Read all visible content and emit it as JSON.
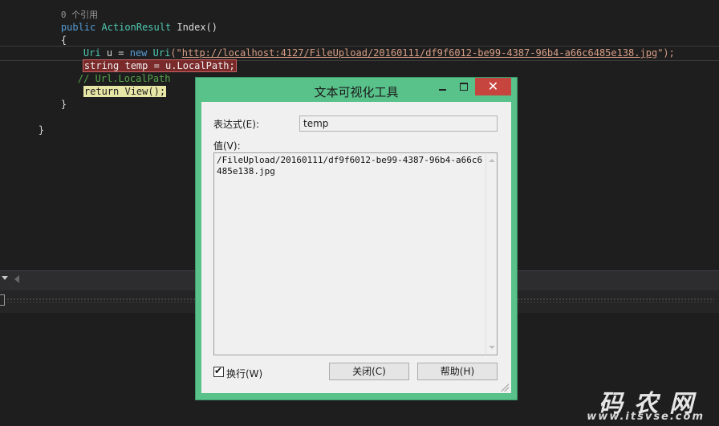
{
  "editor": {
    "references": "0 个引用",
    "lines": {
      "l1_kw": "public",
      "l1_type": "ActionResult",
      "l1_rest": " Index()",
      "l2": "{",
      "l3_type": "Uri",
      "l3_mid": " u = ",
      "l3_kw": "new",
      "l3_type2": " Uri",
      "l3_open": "(\"",
      "l3_url": "http://localhost:4127/FileUpload/20160111/df9f6012-be99-4387-96b4-a66c6485e138.jpg",
      "l3_close": "\");",
      "l4": "string temp = u.LocalPath;",
      "l5": "// Url.LocalPath",
      "l6": "return View();",
      "l7": "}",
      "l8": "}"
    }
  },
  "dialog": {
    "title": "文本可视化工具",
    "expression_label": "表达式(E):",
    "expression_value": "temp",
    "value_label": "值(V):",
    "value_text": "/FileUpload/20160111/df9f6012-be99-4387-96b4-a66c6485e138.jpg",
    "wrap_label": "换行(W)",
    "wrap_checked": true,
    "close_label": "关闭(C)",
    "help_label": "帮助(H)",
    "close_glyph": "✕"
  },
  "watermark": {
    "title": "码农网",
    "url": "www.itsvse.com"
  },
  "colors": {
    "dialog_frame": "#59c18a",
    "close_button": "#c7453f",
    "editor_bg": "#1e1e1e"
  }
}
